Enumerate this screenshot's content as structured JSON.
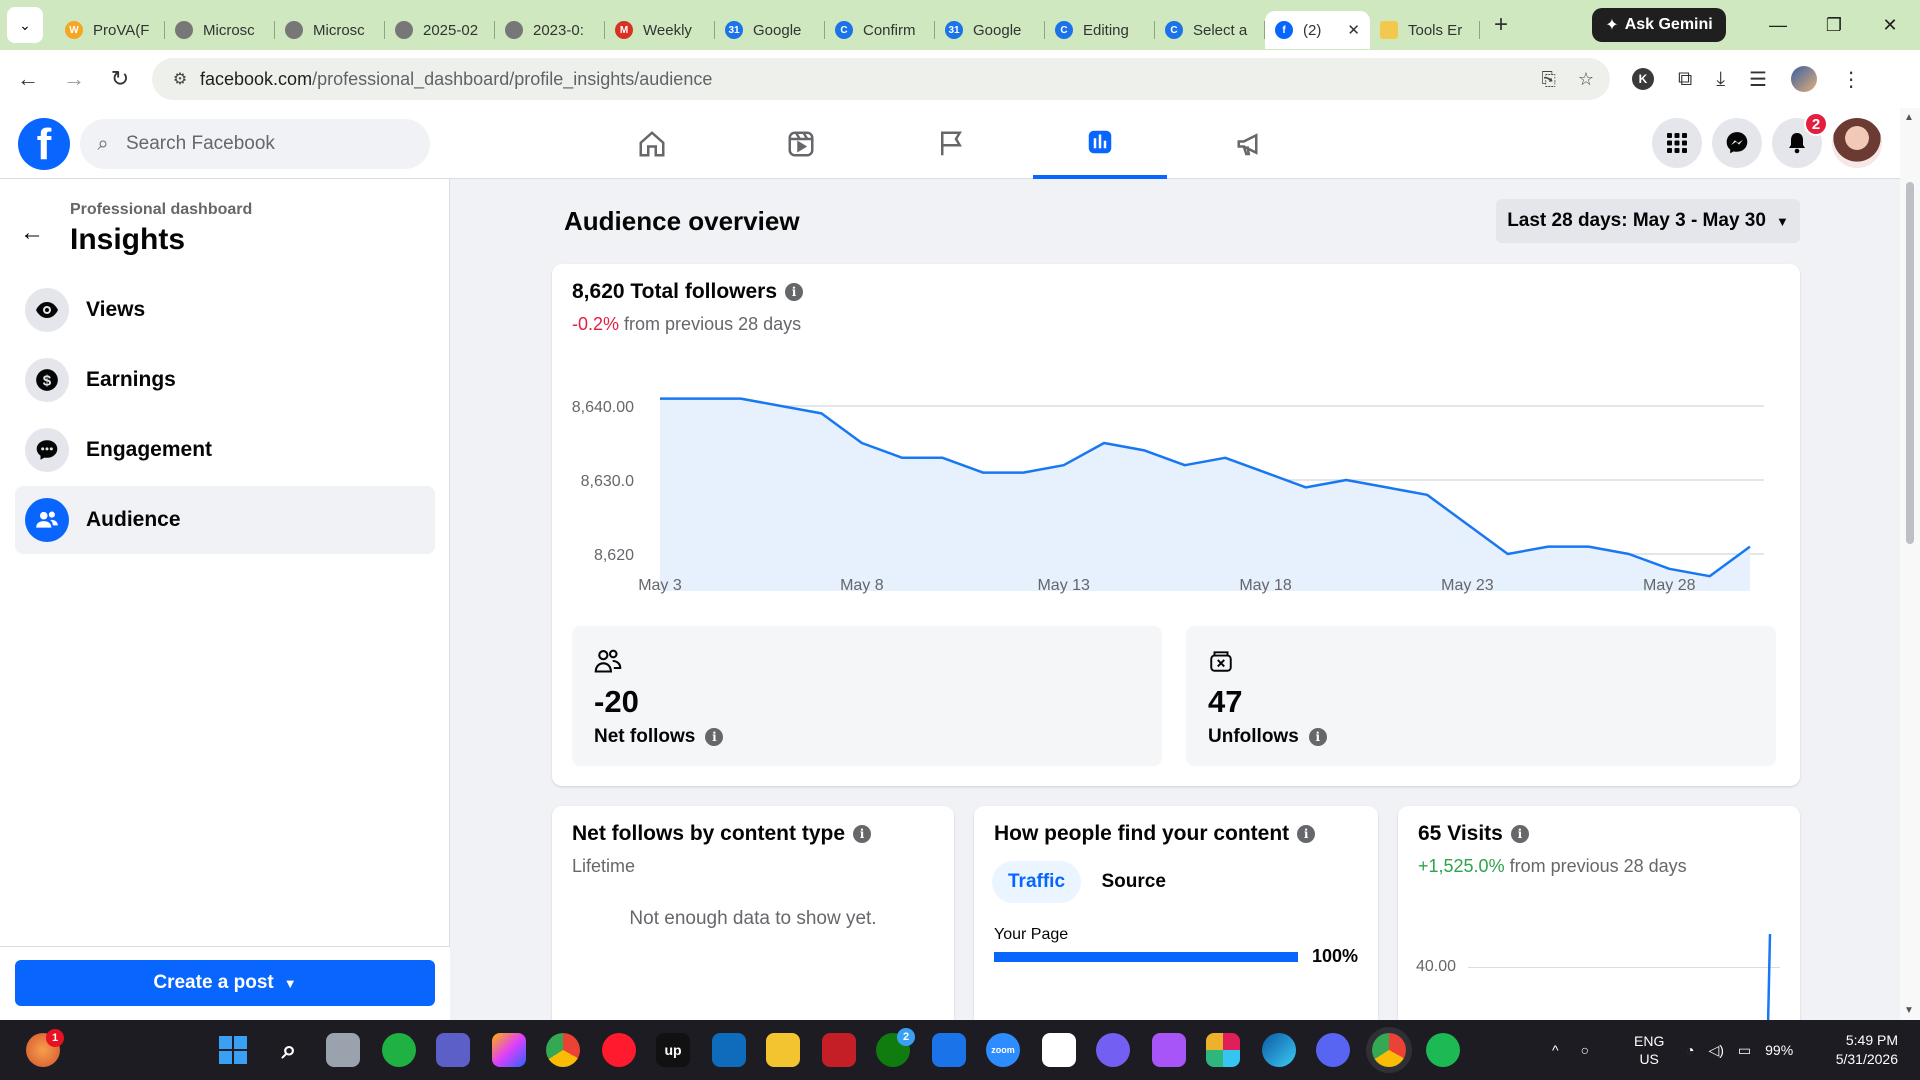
{
  "browser": {
    "tabs": [
      {
        "label": "ProVA(F",
        "color": "#f5a623",
        "glyph": "W"
      },
      {
        "label": "Microsc",
        "color": "#777777",
        "glyph": ""
      },
      {
        "label": "Microsc",
        "color": "#777777",
        "glyph": ""
      },
      {
        "label": "2025-02",
        "color": "#777777",
        "glyph": ""
      },
      {
        "label": "2023-0:",
        "color": "#777777",
        "glyph": ""
      },
      {
        "label": "Weekly",
        "color": "#d93025",
        "glyph": "M"
      },
      {
        "label": "Google",
        "color": "#1a73e8",
        "glyph": "31"
      },
      {
        "label": "Confirm",
        "color": "#1a73e8",
        "glyph": "C"
      },
      {
        "label": "Google",
        "color": "#1a73e8",
        "glyph": "31"
      },
      {
        "label": "Editing",
        "color": "#1a73e8",
        "glyph": "C"
      },
      {
        "label": "Select a",
        "color": "#1a73e8",
        "glyph": "C"
      }
    ],
    "active_tab": {
      "label": "(2)",
      "color": "#0866ff"
    },
    "last_tab": {
      "label": "Tools Er",
      "color": "#f2c94c"
    },
    "gemini_label": "Ask Gemini",
    "url_host": "facebook.com",
    "url_path": "/professional_dashboard/profile_insights/audience",
    "profile_initial": "K"
  },
  "fb": {
    "search_placeholder": "Search Facebook",
    "notif_count": "2"
  },
  "sidebar": {
    "subtitle": "Professional dashboard",
    "title": "Insights",
    "items": [
      {
        "label": "Views",
        "icon": "eye-icon"
      },
      {
        "label": "Earnings",
        "icon": "dollar-icon"
      },
      {
        "label": "Engagement",
        "icon": "chat-icon"
      },
      {
        "label": "Audience",
        "icon": "people-icon"
      }
    ],
    "create_label": "Create a post"
  },
  "main": {
    "title": "Audience overview",
    "range_label": "Last 28 days: May 3 - May 30",
    "followers": {
      "title": "8,620 Total followers",
      "change": "-0.2%",
      "change_suffix": "from previous 28 days"
    },
    "net_follows": {
      "value": "-20",
      "label": "Net follows"
    },
    "unfollows": {
      "value": "47",
      "label": "Unfollows"
    },
    "content_type": {
      "title": "Net follows by content type",
      "subtitle": "Lifetime",
      "empty": "Not enough data to show yet."
    },
    "find_content": {
      "title": "How people find your content",
      "tab_traffic": "Traffic",
      "tab_source": "Source",
      "bar_label": "Your Page",
      "bar_value": "100%",
      "bar_fraction": 1.0
    },
    "visits": {
      "title": "65 Visits",
      "change": "+1,525.0%",
      "change_suffix": "from previous 28 days",
      "y_tick": "40.00"
    }
  },
  "chart_data": {
    "type": "area",
    "y_ticks": [
      {
        "value": 8640,
        "label": "8,640.00"
      },
      {
        "value": 8630,
        "label": "8,630.0"
      },
      {
        "value": 8620,
        "label": "8,620"
      }
    ],
    "x_ticks": [
      {
        "day": 3,
        "label": "May 3"
      },
      {
        "day": 8,
        "label": "May 8"
      },
      {
        "day": 13,
        "label": "May 13"
      },
      {
        "day": 18,
        "label": "May 18"
      },
      {
        "day": 23,
        "label": "May 23"
      },
      {
        "day": 28,
        "label": "May 28"
      }
    ],
    "x": [
      3,
      4,
      5,
      6,
      7,
      8,
      9,
      10,
      11,
      12,
      13,
      14,
      15,
      16,
      17,
      18,
      19,
      20,
      21,
      22,
      23,
      24,
      25,
      26,
      27,
      28,
      29,
      30
    ],
    "values": [
      8641,
      8641,
      8641,
      8640,
      8639,
      8635,
      8633,
      8633,
      8631,
      8631,
      8632,
      8635,
      8634,
      8632,
      8633,
      8631,
      8629,
      8630,
      8629,
      8628,
      8624,
      8620,
      8621,
      8621,
      8620,
      8618,
      8617,
      8621
    ],
    "ylim": [
      8615,
      8645
    ],
    "xlim": [
      3,
      30
    ],
    "grid": true,
    "color": "#1877f2"
  },
  "taskbar": {
    "lang": "ENG",
    "region": "US",
    "battery": "99%",
    "time": "5:49 PM",
    "date": "5/31/2026",
    "copilot_badge": "1",
    "xbox_badge": "2"
  }
}
